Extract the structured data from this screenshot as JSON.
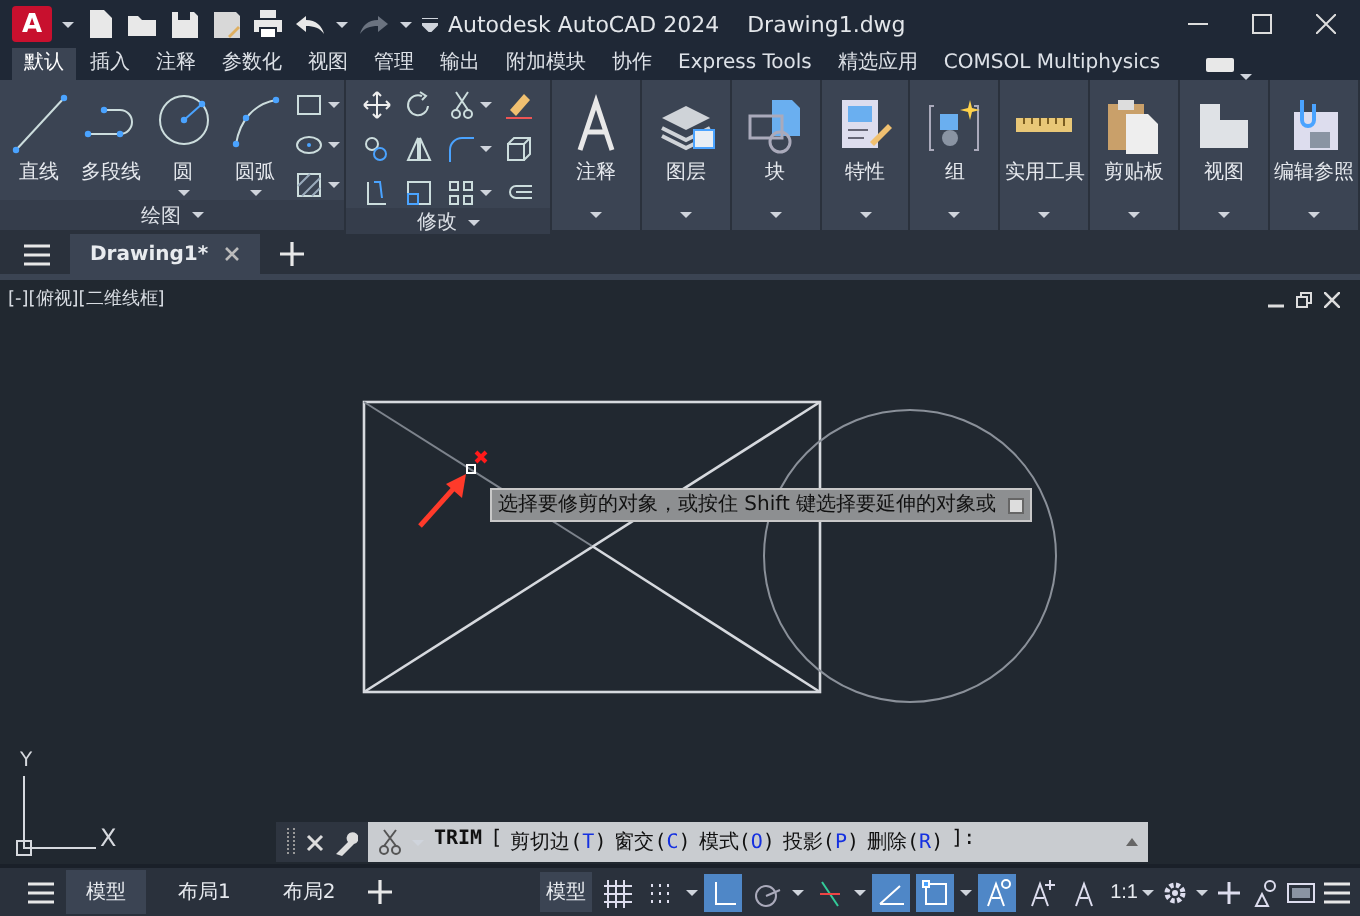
{
  "title_bar": {
    "logo": "A",
    "title": "Autodesk AutoCAD 2024",
    "document": "Drawing1.dwg"
  },
  "ribbon_tabs": [
    {
      "label": "默认",
      "selected": true
    },
    {
      "label": "插入",
      "selected": false
    },
    {
      "label": "注释",
      "selected": false
    },
    {
      "label": "参数化",
      "selected": false
    },
    {
      "label": "视图",
      "selected": false
    },
    {
      "label": "管理",
      "selected": false
    },
    {
      "label": "输出",
      "selected": false
    },
    {
      "label": "附加模块",
      "selected": false
    },
    {
      "label": "协作",
      "selected": false
    },
    {
      "label": "Express Tools",
      "selected": false
    },
    {
      "label": "精选应用",
      "selected": false
    },
    {
      "label": "COMSOL Multiphysics",
      "selected": false
    }
  ],
  "ribbon_panels": [
    {
      "kind": "draw",
      "title": "绘图",
      "tools": [
        {
          "label": "直线"
        },
        {
          "label": "多段线"
        },
        {
          "label": "圆"
        },
        {
          "label": "圆弧"
        }
      ]
    },
    {
      "kind": "modify",
      "title": "修改"
    },
    {
      "kind": "large",
      "label": "注释"
    },
    {
      "kind": "large",
      "label": "图层"
    },
    {
      "kind": "large",
      "label": "块"
    },
    {
      "kind": "large",
      "label": "特性"
    },
    {
      "kind": "large",
      "label": "组"
    },
    {
      "kind": "large",
      "label": "实用工具"
    },
    {
      "kind": "large",
      "label": "剪贴板"
    },
    {
      "kind": "large",
      "label": "视图"
    },
    {
      "kind": "large",
      "label": "编辑参照"
    }
  ],
  "file_tabs": [
    {
      "label": "Drawing1*",
      "selected": true
    }
  ],
  "viewport": {
    "label": "[-][俯视][二维线框]",
    "tooltip": "选择要修剪的对象，或按住 Shift 键选择要延伸的对象或",
    "ucs": {
      "x": "X",
      "y": "Y"
    }
  },
  "command_line": {
    "name": "TRIM",
    "open": "[",
    "options": [
      {
        "before": "剪切边(",
        "key": "T",
        "after": ")"
      },
      {
        "before": "窗交(",
        "key": "C",
        "after": ")"
      },
      {
        "before": "模式(",
        "key": "O",
        "after": ")"
      },
      {
        "before": "投影(",
        "key": "P",
        "after": ")"
      },
      {
        "before": "删除(",
        "key": "R",
        "after": ")"
      }
    ],
    "close": "]:"
  },
  "status_bar": {
    "layout_tabs": [
      {
        "label": "模型",
        "selected": true
      },
      {
        "label": "布局1",
        "selected": false
      },
      {
        "label": "布局2",
        "selected": false
      }
    ],
    "space": "模型",
    "scale": "1:1",
    "toggles": [
      {
        "kind": "grid",
        "on": false
      },
      {
        "kind": "snap",
        "on": false
      },
      {
        "kind": "ortho",
        "on": true
      },
      {
        "kind": "polar",
        "on": false
      },
      {
        "kind": "tracking",
        "on": false
      },
      {
        "kind": "isoangle",
        "on": true
      },
      {
        "kind": "osnap",
        "on": true
      },
      {
        "kind": "annovis",
        "on": true
      },
      {
        "kind": "autoscale",
        "on": false
      },
      {
        "kind": "annoscale",
        "on": false
      }
    ]
  }
}
